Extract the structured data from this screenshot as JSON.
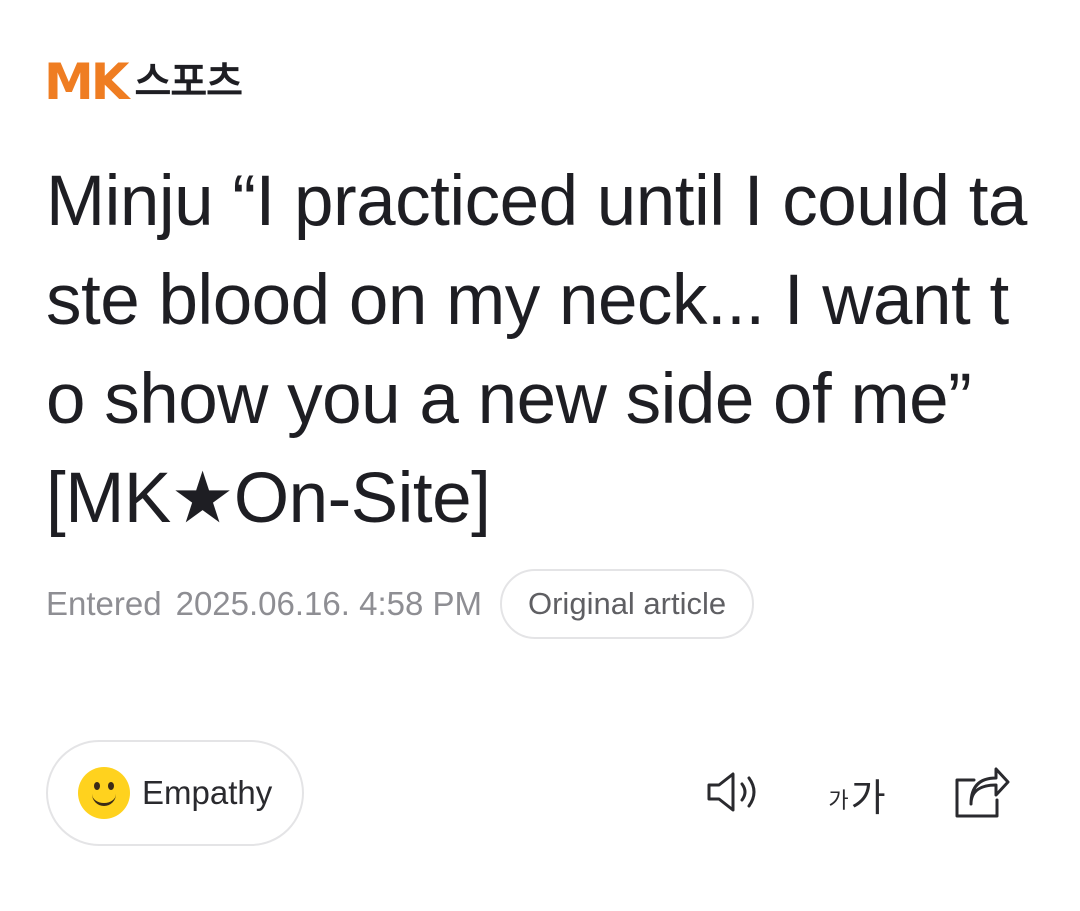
{
  "logo": {
    "brand": "MK",
    "section": "스포츠",
    "brand_color": "#ef7d22"
  },
  "article": {
    "headline": "Minju “I practiced until I could taste blood on my neck... I want to show you a new side of me” [MK★On-Site]",
    "entered_label": "Entered",
    "entered_datetime": "2025.06.16. 4:58 PM",
    "original_article_label": "Original article"
  },
  "actions": {
    "empathy_label": "Empathy",
    "empathy_icon": "smiley-icon",
    "speaker_icon": "speaker-icon",
    "font_size_small": "가",
    "font_size_big": "가",
    "share_icon": "share-icon"
  }
}
